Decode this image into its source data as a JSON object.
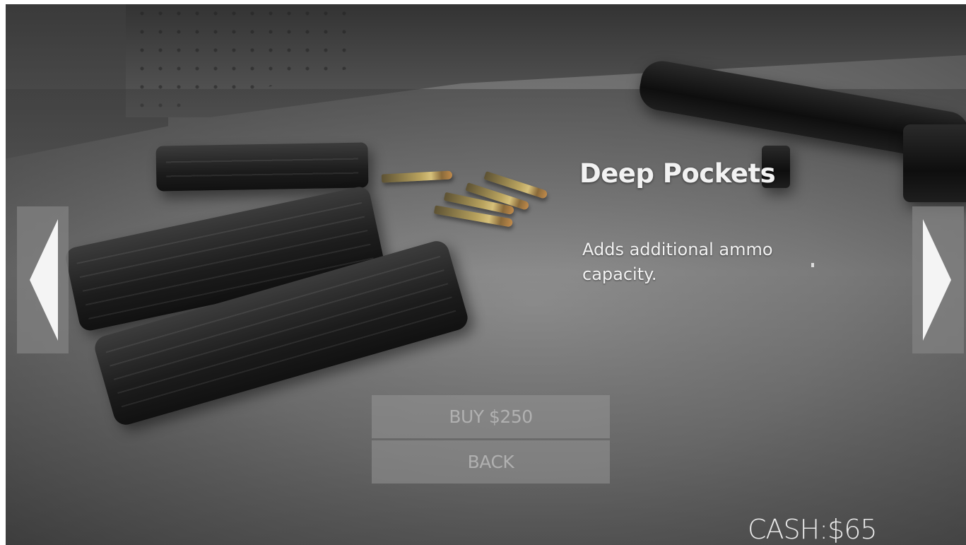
{
  "item": {
    "title": "Deep Pockets",
    "description": "Adds additional ammo capacity."
  },
  "buttons": {
    "buy_label": "BUY $250",
    "back_label": "BACK"
  },
  "hud": {
    "cash_label": "CASH:$65"
  },
  "navigation": {
    "prev_icon": "triangle-left-icon",
    "next_icon": "triangle-right-icon"
  },
  "colors": {
    "text": "#f2f2f2",
    "button_bg": "#969696",
    "button_text": "#b9b9b9",
    "arrow_panel": "#828282"
  }
}
